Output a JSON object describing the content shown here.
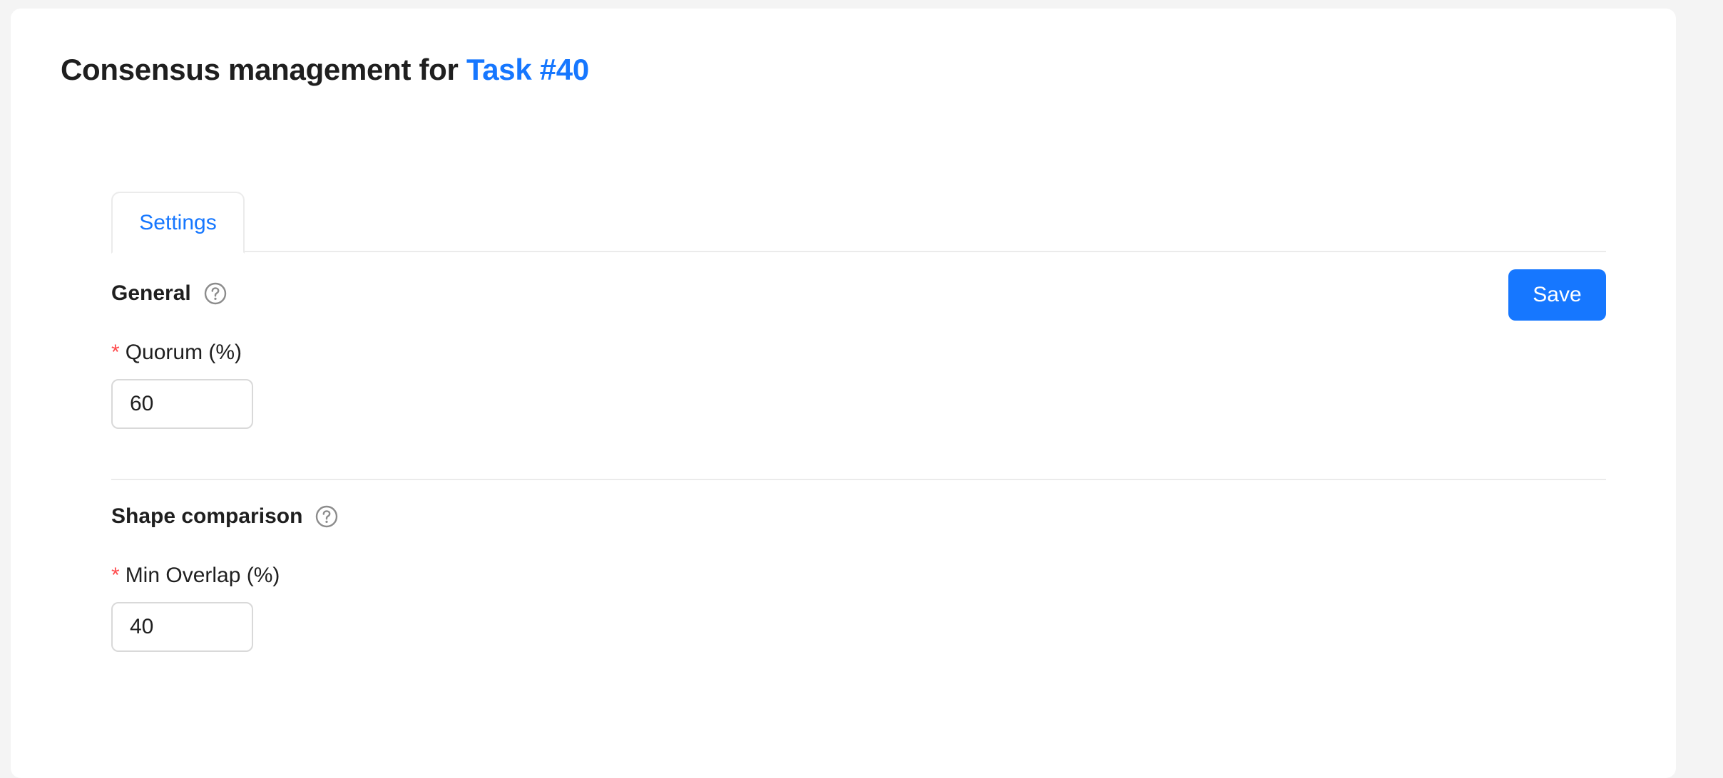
{
  "header": {
    "title_prefix": "Consensus management for",
    "task_link": "Task #40"
  },
  "tabs": [
    {
      "label": "Settings",
      "active": true
    }
  ],
  "toolbar": {
    "save_label": "Save"
  },
  "sections": {
    "general": {
      "title": "General",
      "help_icon": "question-circle-icon",
      "fields": {
        "quorum": {
          "label": "Quorum (%)",
          "required_mark": "*",
          "value": "60"
        }
      }
    },
    "shape_comparison": {
      "title": "Shape comparison",
      "help_icon": "question-circle-icon",
      "fields": {
        "min_overlap": {
          "label": "Min Overlap (%)",
          "required_mark": "*",
          "value": "40"
        }
      }
    }
  },
  "colors": {
    "accent": "#1677ff",
    "required": "#ff4d4f",
    "divider": "#ebebeb",
    "page_background": "#f4f4f4"
  }
}
